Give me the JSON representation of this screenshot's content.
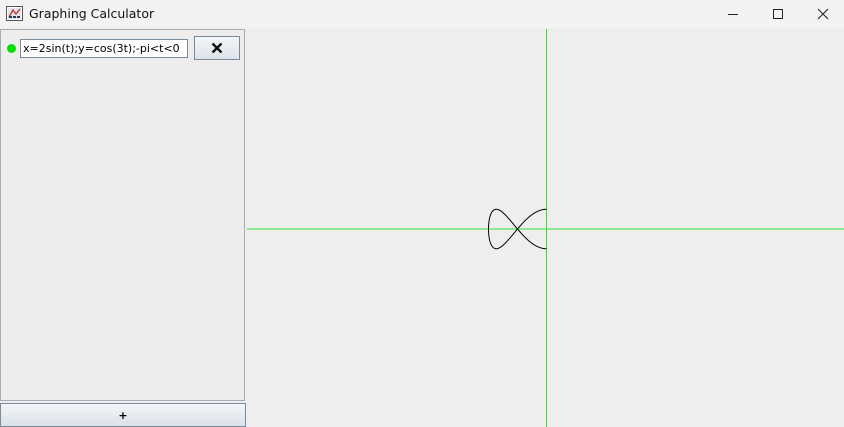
{
  "window": {
    "title": "Graphing Calculator",
    "icons": {
      "app": "calculator-app-icon",
      "minimize": "minimize-icon",
      "maximize": "maximize-icon",
      "close": "close-icon"
    }
  },
  "sidebar": {
    "expressions": [
      {
        "value": "x=2sin(t);y=cos(3t);-pi<t<0",
        "color": "#00e000",
        "remove_icon": "close-x-icon"
      }
    ],
    "add_label": "+"
  },
  "graph": {
    "axis_color": "#33dd33",
    "curve_color": "#000000",
    "background": "#eeeeee"
  }
}
